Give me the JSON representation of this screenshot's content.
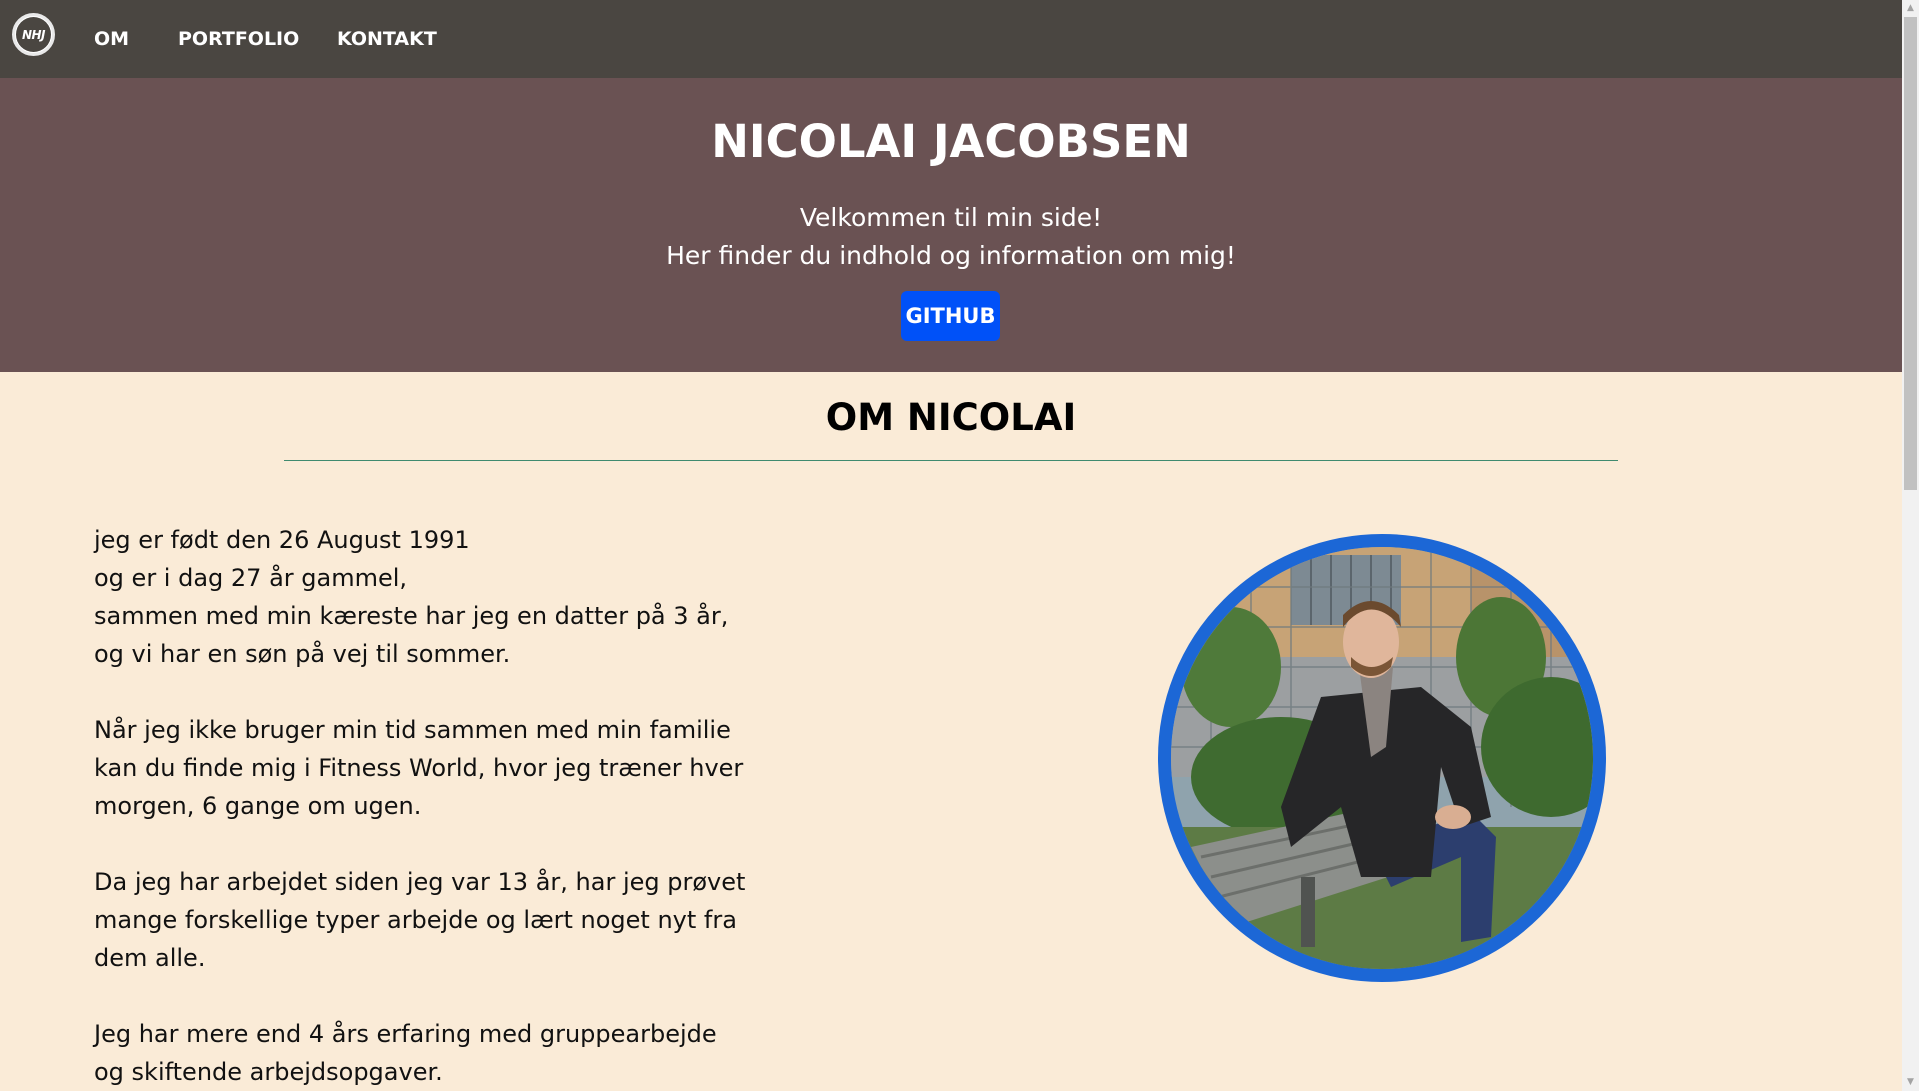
{
  "nav": {
    "logo_text": "NHJ",
    "items": [
      {
        "label": "OM"
      },
      {
        "label": "PORTFOLIO"
      },
      {
        "label": "KONTAKT"
      }
    ]
  },
  "hero": {
    "title": "NICOLAI JACOBSEN",
    "line1": "Velkommen til min side!",
    "line2": "Her finder du indhold og information om mig!",
    "github_label": "GITHUB",
    "background_color": "#6a5253",
    "button_color": "#0051f8"
  },
  "about": {
    "title": "OM NICOLAI",
    "paragraphs": [
      [
        "jeg er født den 26 August 1991",
        "og er i dag 27 år gammel,",
        "sammen med min kæreste har jeg en datter på 3 år,",
        "og vi har en søn på vej til sommer."
      ],
      [
        "Når jeg ikke bruger min tid sammen med min familie",
        "kan du finde mig i Fitness World, hvor jeg træner hver",
        "morgen, 6 gange om ugen."
      ],
      [
        "Da jeg har arbejdet siden jeg var 13 år, har jeg prøvet",
        "mange forskellige typer arbejde og lært noget nyt fra",
        "dem alle."
      ],
      [
        "Jeg har mere end 4 års erfaring med gruppearbejde",
        "og skiftende arbejdsopgaver."
      ]
    ],
    "photo_border_color": "#1c67d6"
  },
  "icons": {
    "scroll_up": "▲",
    "scroll_down": "▼"
  },
  "colors": {
    "navbar": "#4a4641",
    "page_background": "#faebd7",
    "divider": "#3f8a6f"
  }
}
